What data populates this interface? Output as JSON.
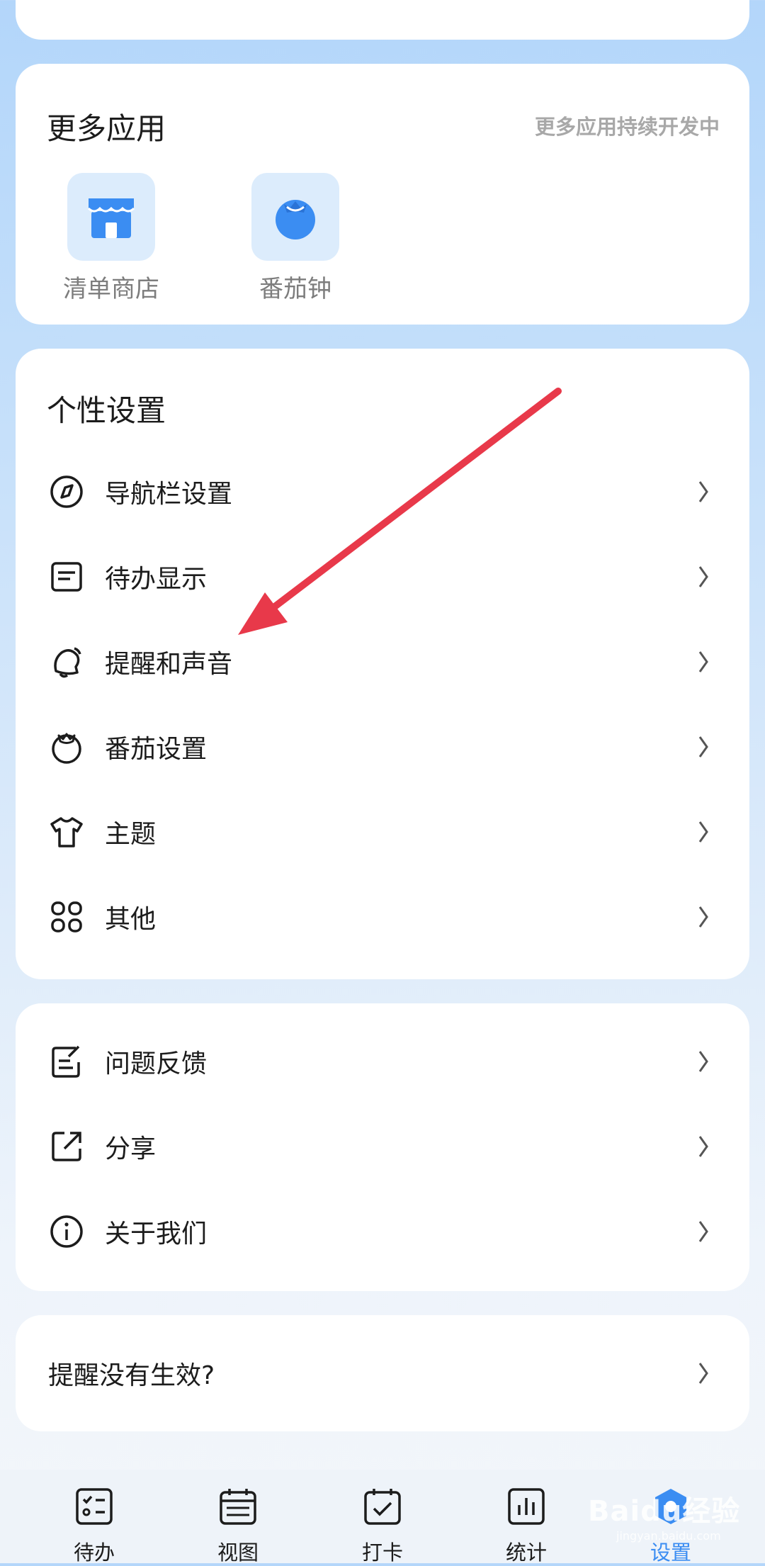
{
  "apps_section": {
    "title": "更多应用",
    "hint": "更多应用持续开发中",
    "items": [
      {
        "label": "清单商店",
        "icon": "store-icon"
      },
      {
        "label": "番茄钟",
        "icon": "tomato-icon"
      }
    ]
  },
  "personal_section": {
    "title": "个性设置",
    "items": [
      {
        "label": "导航栏设置",
        "icon": "compass-icon"
      },
      {
        "label": "待办显示",
        "icon": "todo-card-icon"
      },
      {
        "label": "提醒和声音",
        "icon": "bell-icon"
      },
      {
        "label": "番茄设置",
        "icon": "tomato-outline-icon"
      },
      {
        "label": "主题",
        "icon": "tshirt-icon"
      },
      {
        "label": "其他",
        "icon": "grid-icon"
      }
    ]
  },
  "misc_section": {
    "items": [
      {
        "label": "问题反馈",
        "icon": "feedback-icon"
      },
      {
        "label": "分享",
        "icon": "share-icon"
      },
      {
        "label": "关于我们",
        "icon": "info-icon"
      }
    ]
  },
  "help": {
    "label": "提醒没有生效?"
  },
  "tabbar": {
    "tabs": [
      {
        "label": "待办",
        "icon": "checklist-icon",
        "active": false
      },
      {
        "label": "视图",
        "icon": "calendar-icon",
        "active": false
      },
      {
        "label": "打卡",
        "icon": "checkin-icon",
        "active": false
      },
      {
        "label": "统计",
        "icon": "stats-icon",
        "active": false
      },
      {
        "label": "设置",
        "icon": "settings-icon",
        "active": true
      }
    ]
  },
  "watermark": {
    "text": "Baidu经验",
    "sub": "jingyan.baidu.com"
  },
  "colors": {
    "accent": "#3b8df2",
    "annotation_arrow": "#e8394a",
    "app_icon_bg": "#dcecfc"
  }
}
